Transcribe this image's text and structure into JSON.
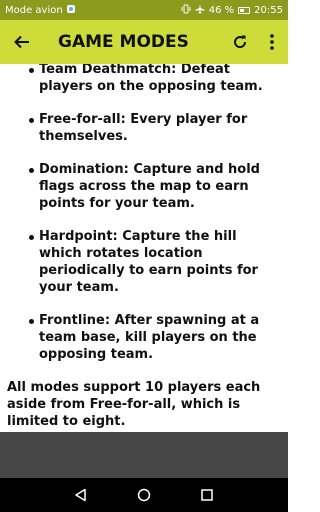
{
  "status_bar": {
    "carrier": "Mode avion",
    "battery": "46 %",
    "time": "20:55",
    "icons": [
      "notification-icon",
      "vibrate-icon",
      "airplane-mode-icon",
      "battery-icon"
    ]
  },
  "toolbar": {
    "title": "GAME MODES",
    "icons": [
      "back-arrow-icon",
      "refresh-icon",
      "more-vert-icon"
    ]
  },
  "modes": [
    "Team Deathmatch: Defeat players on the opposing team.",
    "Free-for-all: Every player for themselves.",
    "Domination: Capture and hold flags across the map to earn points for your team.",
    "Hardpoint: Capture the hill which rotates location periodically to earn points for your team.",
    "Frontline: After spawning at a team base, kill players on the opposing team."
  ],
  "summary": "All modes support 10 players each aside from Free-for-all, which is limited to eight.",
  "navigation": {
    "icons": [
      "back-triangle-icon",
      "home-circle-icon",
      "recents-square-icon"
    ]
  },
  "colors": {
    "status_bar": "#8c9a1d",
    "toolbar": "#cddc39",
    "footer_band": "#474747",
    "nav_bar": "#000000"
  }
}
